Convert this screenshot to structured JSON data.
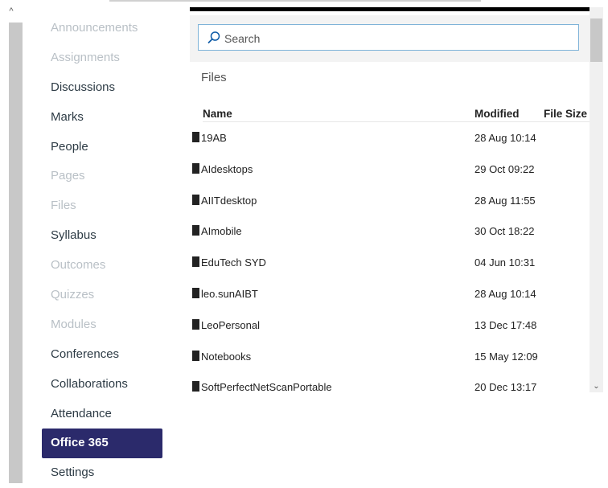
{
  "scrollbar": {
    "up_glyph": "^",
    "down_glyph": "⌄"
  },
  "nav": {
    "items": [
      {
        "label": "Announcements",
        "state": "disabled"
      },
      {
        "label": "Assignments",
        "state": "disabled"
      },
      {
        "label": "Discussions",
        "state": "enabled"
      },
      {
        "label": "Marks",
        "state": "enabled"
      },
      {
        "label": "People",
        "state": "enabled"
      },
      {
        "label": "Pages",
        "state": "disabled"
      },
      {
        "label": "Files",
        "state": "disabled"
      },
      {
        "label": "Syllabus",
        "state": "enabled"
      },
      {
        "label": "Outcomes",
        "state": "disabled"
      },
      {
        "label": "Quizzes",
        "state": "disabled"
      },
      {
        "label": "Modules",
        "state": "disabled"
      },
      {
        "label": "Conferences",
        "state": "enabled"
      },
      {
        "label": "Collaborations",
        "state": "enabled"
      },
      {
        "label": "Attendance",
        "state": "enabled"
      },
      {
        "label": "Office 365",
        "state": "active"
      },
      {
        "label": "Settings",
        "state": "enabled"
      }
    ]
  },
  "files_panel": {
    "search_placeholder": "Search",
    "title": "Files",
    "columns": {
      "name": "Name",
      "modified": "Modified",
      "size": "File Size"
    },
    "rows": [
      {
        "name": "19AB",
        "modified": "28 Aug 10:14",
        "size": ""
      },
      {
        "name": "AIdesktops",
        "modified": "29 Oct 09:22",
        "size": ""
      },
      {
        "name": "AIITdesktop",
        "modified": "28 Aug 11:55",
        "size": ""
      },
      {
        "name": "AImobile",
        "modified": "30 Oct 18:22",
        "size": ""
      },
      {
        "name": "EduTech SYD",
        "modified": "04 Jun 10:31",
        "size": ""
      },
      {
        "name": "leo.sunAIBT",
        "modified": "28 Aug 10:14",
        "size": ""
      },
      {
        "name": "LeoPersonal",
        "modified": "13 Dec 17:48",
        "size": ""
      },
      {
        "name": "Notebooks",
        "modified": "15 May 12:09",
        "size": ""
      },
      {
        "name": "SoftPerfectNetScanPortable",
        "modified": "20 Dec 13:17",
        "size": ""
      }
    ]
  },
  "colors": {
    "active_nav_bg": "#2b2a6b",
    "disabled_text": "#b9c0c6",
    "search_border": "#7fb3d8"
  },
  "icons": {
    "search": "search-icon",
    "folder": "folder-icon"
  }
}
